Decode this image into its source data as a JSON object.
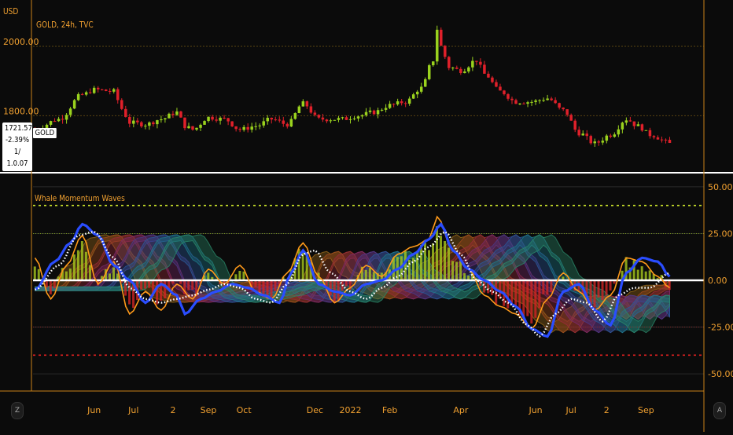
{
  "header": {
    "currency": "USD",
    "symbol_line": "GOLD, 24h, TVC",
    "last_price": "1721.57",
    "change_pct": "-2.39%",
    "extra_value": "1/ 1.0.07",
    "symbol_tag": "GOLD"
  },
  "indicator": {
    "title": "Whale Momentum Waves"
  },
  "corners": {
    "left": "Z",
    "right": "A"
  },
  "colors": {
    "accent": "#f0a030",
    "up_candle": "#9ad21e",
    "down_candle": "#e0202a",
    "zero_line": "#ffffff",
    "upper_dotted": "#c8e02a",
    "lower_dotted": "#e02020",
    "fast_line": "#2a4dff",
    "signal_dots": "#ffffff",
    "osc_orange": "#ff9a1a"
  },
  "chart_data": [
    {
      "type": "candlestick",
      "title": "GOLD, 24h, TVC",
      "ylabel": "USD",
      "ylim": [
        1640,
        2120
      ],
      "yticks": [
        1800,
        2000
      ],
      "ytick_labels": [
        "1800.00",
        "2000.00"
      ],
      "x_tick_labels": [
        "Jun",
        "Jul",
        "2",
        "Sep",
        "Oct",
        "Dec",
        "2022",
        "Feb",
        "Apr",
        "Jun",
        "Jul",
        "2",
        "Sep"
      ],
      "x_tick_index": [
        15,
        25,
        35,
        44,
        53,
        71,
        80,
        90,
        108,
        127,
        136,
        145,
        155
      ],
      "n": 162,
      "anchors": [
        [
          0,
          1760
        ],
        [
          6,
          1790
        ],
        [
          12,
          1860
        ],
        [
          15,
          1875
        ],
        [
          20,
          1870
        ],
        [
          22,
          1820
        ],
        [
          24,
          1780
        ],
        [
          28,
          1775
        ],
        [
          32,
          1790
        ],
        [
          36,
          1810
        ],
        [
          38,
          1770
        ],
        [
          40,
          1760
        ],
        [
          44,
          1795
        ],
        [
          48,
          1790
        ],
        [
          52,
          1760
        ],
        [
          56,
          1770
        ],
        [
          60,
          1790
        ],
        [
          64,
          1775
        ],
        [
          68,
          1835
        ],
        [
          72,
          1790
        ],
        [
          78,
          1790
        ],
        [
          82,
          1800
        ],
        [
          86,
          1810
        ],
        [
          90,
          1830
        ],
        [
          94,
          1840
        ],
        [
          98,
          1880
        ],
        [
          101,
          1960
        ],
        [
          102,
          2050
        ],
        [
          103,
          2000
        ],
        [
          105,
          1940
        ],
        [
          108,
          1930
        ],
        [
          112,
          1960
        ],
        [
          114,
          1920
        ],
        [
          118,
          1870
        ],
        [
          122,
          1840
        ],
        [
          126,
          1840
        ],
        [
          130,
          1850
        ],
        [
          134,
          1815
        ],
        [
          138,
          1750
        ],
        [
          142,
          1720
        ],
        [
          146,
          1745
        ],
        [
          150,
          1790
        ],
        [
          153,
          1770
        ],
        [
          156,
          1745
        ],
        [
          161,
          1722
        ]
      ],
      "last_value": 1721.57,
      "last_change_pct": -2.39
    },
    {
      "type": "oscillator",
      "title": "Whale Momentum Waves",
      "ylim": [
        -55,
        55
      ],
      "yticks": [
        50,
        25,
        0,
        -25,
        -50
      ],
      "ytick_labels": [
        "50.00",
        "25.00",
        "0.00",
        "-25.00",
        "-50.00"
      ],
      "levels": {
        "upper_dotted": 40,
        "lower_dotted": -40,
        "upper_solid": 25,
        "lower_solid": -25
      },
      "n": 162,
      "fast_line": [
        [
          0,
          -5
        ],
        [
          5,
          10
        ],
        [
          9,
          20
        ],
        [
          12,
          30
        ],
        [
          16,
          24
        ],
        [
          20,
          8
        ],
        [
          24,
          0
        ],
        [
          28,
          -12
        ],
        [
          32,
          -2
        ],
        [
          36,
          -8
        ],
        [
          38,
          -18
        ],
        [
          42,
          -10
        ],
        [
          46,
          -6
        ],
        [
          50,
          -2
        ],
        [
          54,
          -4
        ],
        [
          58,
          -8
        ],
        [
          62,
          -12
        ],
        [
          65,
          4
        ],
        [
          68,
          16
        ],
        [
          72,
          -2
        ],
        [
          76,
          -6
        ],
        [
          80,
          -8
        ],
        [
          84,
          -2
        ],
        [
          88,
          0
        ],
        [
          92,
          6
        ],
        [
          96,
          14
        ],
        [
          100,
          22
        ],
        [
          103,
          30
        ],
        [
          106,
          16
        ],
        [
          110,
          6
        ],
        [
          114,
          0
        ],
        [
          118,
          -6
        ],
        [
          122,
          -14
        ],
        [
          126,
          -26
        ],
        [
          130,
          -30
        ],
        [
          134,
          -6
        ],
        [
          138,
          -2
        ],
        [
          142,
          -16
        ],
        [
          146,
          -24
        ],
        [
          150,
          4
        ],
        [
          154,
          12
        ],
        [
          158,
          10
        ],
        [
          161,
          2
        ]
      ],
      "signal_dots": [
        [
          0,
          -5
        ],
        [
          6,
          8
        ],
        [
          11,
          24
        ],
        [
          15,
          26
        ],
        [
          20,
          12
        ],
        [
          24,
          -4
        ],
        [
          28,
          -10
        ],
        [
          32,
          -12
        ],
        [
          36,
          -10
        ],
        [
          40,
          -8
        ],
        [
          44,
          -5
        ],
        [
          48,
          -2
        ],
        [
          52,
          -4
        ],
        [
          56,
          -10
        ],
        [
          60,
          -12
        ],
        [
          64,
          -2
        ],
        [
          68,
          14
        ],
        [
          71,
          16
        ],
        [
          75,
          4
        ],
        [
          80,
          -6
        ],
        [
          84,
          -10
        ],
        [
          88,
          -4
        ],
        [
          92,
          2
        ],
        [
          96,
          10
        ],
        [
          100,
          18
        ],
        [
          104,
          26
        ],
        [
          108,
          14
        ],
        [
          112,
          0
        ],
        [
          116,
          -6
        ],
        [
          120,
          -12
        ],
        [
          125,
          -24
        ],
        [
          128,
          -30
        ],
        [
          132,
          -18
        ],
        [
          136,
          -10
        ],
        [
          140,
          -12
        ],
        [
          144,
          -22
        ],
        [
          148,
          -8
        ],
        [
          152,
          -4
        ],
        [
          156,
          -4
        ],
        [
          161,
          4
        ]
      ],
      "osc_orange": [
        [
          0,
          12
        ],
        [
          4,
          -10
        ],
        [
          8,
          8
        ],
        [
          12,
          24
        ],
        [
          16,
          -2
        ],
        [
          20,
          10
        ],
        [
          24,
          -18
        ],
        [
          28,
          -6
        ],
        [
          32,
          -16
        ],
        [
          36,
          -2
        ],
        [
          40,
          -10
        ],
        [
          44,
          6
        ],
        [
          48,
          -2
        ],
        [
          52,
          8
        ],
        [
          56,
          -6
        ],
        [
          60,
          -10
        ],
        [
          64,
          4
        ],
        [
          68,
          20
        ],
        [
          72,
          2
        ],
        [
          76,
          -12
        ],
        [
          80,
          -4
        ],
        [
          84,
          8
        ],
        [
          88,
          2
        ],
        [
          92,
          14
        ],
        [
          96,
          18
        ],
        [
          100,
          22
        ],
        [
          102,
          34
        ],
        [
          106,
          16
        ],
        [
          110,
          6
        ],
        [
          114,
          -8
        ],
        [
          118,
          -14
        ],
        [
          122,
          -18
        ],
        [
          126,
          -26
        ],
        [
          130,
          -10
        ],
        [
          134,
          4
        ],
        [
          138,
          -6
        ],
        [
          142,
          -16
        ],
        [
          146,
          -8
        ],
        [
          150,
          12
        ],
        [
          154,
          10
        ],
        [
          158,
          2
        ],
        [
          161,
          -4
        ]
      ],
      "waves": [
        {
          "color": "#9a6a1a",
          "lag": 3
        },
        {
          "color": "#a04a1e",
          "lag": 6
        },
        {
          "color": "#9a2a3a",
          "lag": 9
        },
        {
          "color": "#7a2a6a",
          "lag": 12
        },
        {
          "color": "#4a3a8a",
          "lag": 15
        },
        {
          "color": "#2a5a9a",
          "lag": 18
        },
        {
          "color": "#1e7a8a",
          "lag": 21
        },
        {
          "color": "#2a8a6a",
          "lag": 24
        }
      ]
    }
  ]
}
